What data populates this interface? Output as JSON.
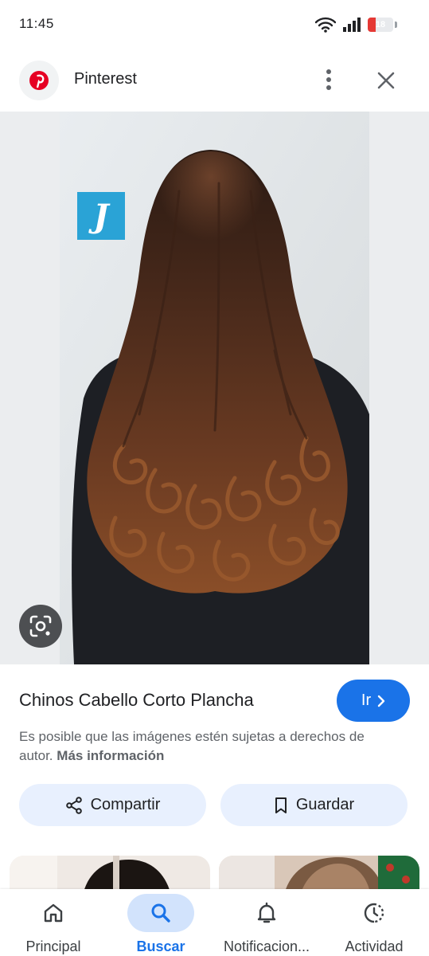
{
  "status_bar": {
    "time": "11:45",
    "battery_level": "18",
    "battery_fraction": 0.18
  },
  "header": {
    "site_name": "Pinterest"
  },
  "image": {
    "watermark_letter": "J"
  },
  "result": {
    "title": "Chinos Cabello Corto Plancha",
    "go_label": "Ir",
    "notice_text": "Es posible que las imágenes estén sujetas a derechos de autor.",
    "notice_link": "Más información"
  },
  "actions": {
    "share_label": "Compartir",
    "save_label": "Guardar"
  },
  "nav": {
    "items": [
      {
        "label": "Principal",
        "icon": "home-icon",
        "active": false
      },
      {
        "label": "Buscar",
        "icon": "search-icon",
        "active": true
      },
      {
        "label": "Notificacion...",
        "icon": "bell-icon",
        "active": false
      },
      {
        "label": "Actividad",
        "icon": "activity-icon",
        "active": false
      }
    ]
  },
  "colors": {
    "accent": "#1a73e8",
    "pill_bg": "#e8f0fe",
    "pinterest_red": "#e60023",
    "battery_low": "#e53935"
  }
}
